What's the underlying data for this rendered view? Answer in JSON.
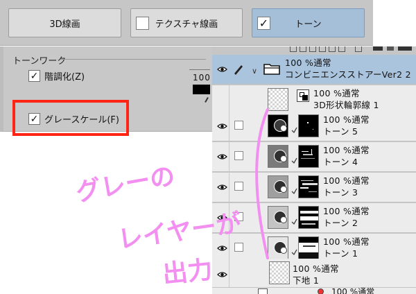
{
  "top_buttons": {
    "line_label": "3D線画",
    "texture_label": "テクスチャ線画",
    "tone_label": "トーン",
    "texture_checked": false,
    "tone_checked": true,
    "check_glyph": "✓"
  },
  "tone_work": {
    "title": "トーンワーク",
    "option1_label": "階調化(Z)",
    "option2_label": "グレースケール(F)",
    "value": "100"
  },
  "layers": {
    "folder": {
      "line1": "100 %通常",
      "line2": "コンビニエンスストアーVer2 2"
    },
    "items": [
      {
        "line1": "100 %通常",
        "line2": "3D形状輪郭線 1"
      },
      {
        "line1": "100 %通常",
        "line2": "トーン 5"
      },
      {
        "line1": "100 %通常",
        "line2": "トーン 4"
      },
      {
        "line1": "100 %通常",
        "line2": "トーン 3"
      },
      {
        "line1": "100 %通常",
        "line2": "トーン 2"
      },
      {
        "line1": "100 %通常",
        "line2": "トーン 1"
      },
      {
        "line1": "100 %通常",
        "line2": "下地 1"
      }
    ],
    "partial_label": "100 %通常"
  },
  "annotation": {
    "line1": "グレーの",
    "line2": "レイヤーが",
    "line3": "出力",
    "color": "#f38ff0"
  },
  "colors": {
    "selected_row": "#abc4dd",
    "active_button": "#a6bfd9",
    "highlight_box": "#ff2414"
  }
}
